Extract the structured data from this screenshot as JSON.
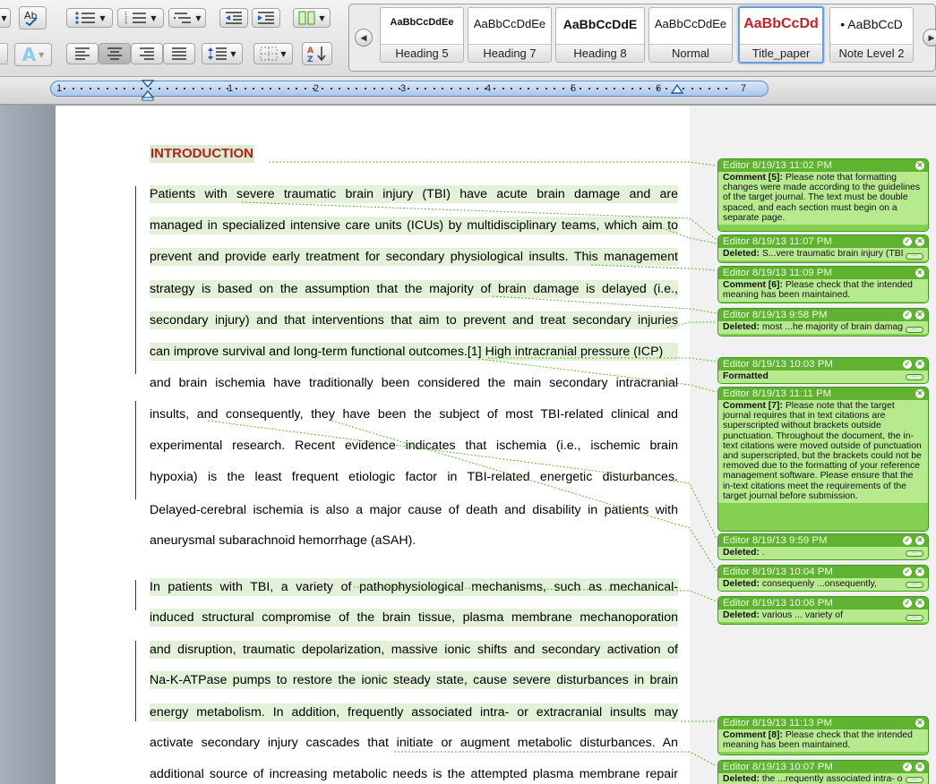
{
  "toolbar": {
    "icons": [
      "spelling-icon",
      "bullets-icon",
      "numbering-icon",
      "multilevel-list-icon",
      "decrease-indent-icon",
      "increase-indent-icon",
      "columns-icon",
      "text-effects-icon",
      "align-left-icon",
      "align-center-icon",
      "align-right-icon",
      "justify-icon",
      "line-spacing-icon",
      "borders-icon",
      "sort-icon"
    ]
  },
  "styles": [
    {
      "preview": "AaBbCcDdEe",
      "name": "Heading 5"
    },
    {
      "preview": "AaBbCcDdEe",
      "name": "Heading 7"
    },
    {
      "preview": "AaBbCcDdE",
      "name": "Heading 8"
    },
    {
      "preview": "AaBbCcDdEe",
      "name": "Normal"
    },
    {
      "preview": "AaBbCcDd",
      "name": "Title_paper"
    },
    {
      "preview": "• AaBbCcD",
      "name": "Note Level 2"
    }
  ],
  "ruler": {
    "marks": [
      "1",
      "1",
      "2",
      "3",
      "4",
      "5",
      "6",
      "7"
    ]
  },
  "doc": {
    "heading": "INTRODUCTION",
    "lines": [
      "Patients with severe traumatic brain injury (TBI) have acute brain damage and are",
      "managed in specialized intensive care units (ICUs) by multidisciplinary teams, which aim to",
      "prevent and provide early treatment for secondary physiological insults. This management",
      "strategy is based on the assumption that the majority of brain damage is delayed (i.e.,",
      "secondary injury) and that interventions that aim to prevent and treat secondary injuries",
      "can improve survival and long-term functional outcomes.[1] High intracranial pressure (ICP)",
      "and brain ischemia have traditionally been considered the main secondary intracranial",
      "insults, and consequently, they have been the subject of most TBI-related clinical and",
      "experimental research. Recent evidence indicates that ischemia (i.e., ischemic brain",
      "hypoxia) is the least frequent etiologic factor in TBI-related energetic disturbances.",
      "Delayed-cerebral ischemia is also a major cause of death and disability in patients with",
      "aneurysmal subarachnoid hemorrhage (aSAH).",
      "In patients with TBI, a variety of pathophysiological mechanisms, such as mechanical-",
      "induced structural compromise of the brain tissue, plasma membrane mechanoporation",
      "and disruption, traumatic depolarization, massive ionic shifts and secondary activation of",
      "Na-K-ATPase pumps to restore the ionic steady state, cause severe disturbances in brain",
      "energy metabolism. In addition, frequently associated intra- or extracranial insults may",
      "activate secondary injury cascades that initiate or augment metabolic disturbances. An",
      "additional source of increasing metabolic needs is the attempted plasma membrane repair"
    ]
  },
  "comments": [
    {
      "header": "Editor   8/19/13 11:02 PM",
      "label": "Comment [5]:",
      "text": "Please note that formatting changes were made according to the guidelines of the target journal. The text must be double spaced, and each section must begin on a separate page."
    },
    {
      "header": "Editor   8/19/13 11:07 PM",
      "label": "Deleted:",
      "text": "S...vere traumatic brain injury (TBI"
    },
    {
      "header": "Editor   8/19/13 11:09 PM",
      "label": "Comment [6]:",
      "text": "Please check that the intended meaning has been maintained."
    },
    {
      "header": "Editor   8/19/13 9:58 PM",
      "label": "Deleted:",
      "text": "most ...he majority of brain damag"
    },
    {
      "header": "Editor   8/19/13 10:03 PM",
      "label": "Formatted",
      "text": ""
    },
    {
      "header": "Editor   8/19/13 11:11 PM",
      "label": "Comment [7]:",
      "text": "Please note that the target journal requires that in text citations are superscripted without brackets outside punctuation. Throughout the document, the in-text citations were moved outside of punctuation and superscripted, but the brackets could not be removed due to the formatting of your reference management software. Please ensure that the in-text citations meet the requirements of the target journal before submission."
    },
    {
      "header": "Editor   8/19/13 9:59 PM",
      "label": "Deleted:",
      "text": "."
    },
    {
      "header": "Editor   8/19/13 10:04 PM",
      "label": "Deleted:",
      "text": "consequenly ...onsequently,"
    },
    {
      "header": "Editor   8/19/13 10:06 PM",
      "label": "Deleted:",
      "text": "various ... variety of"
    },
    {
      "header": "Editor   8/19/13 11:13 PM",
      "label": "Comment [8]:",
      "text": "Please check that the intended meaning has been maintained."
    },
    {
      "header": "Editor   8/19/13 10:07 PM",
      "label": "Deleted:",
      "text": "the ...requently associated intra- o"
    }
  ]
}
